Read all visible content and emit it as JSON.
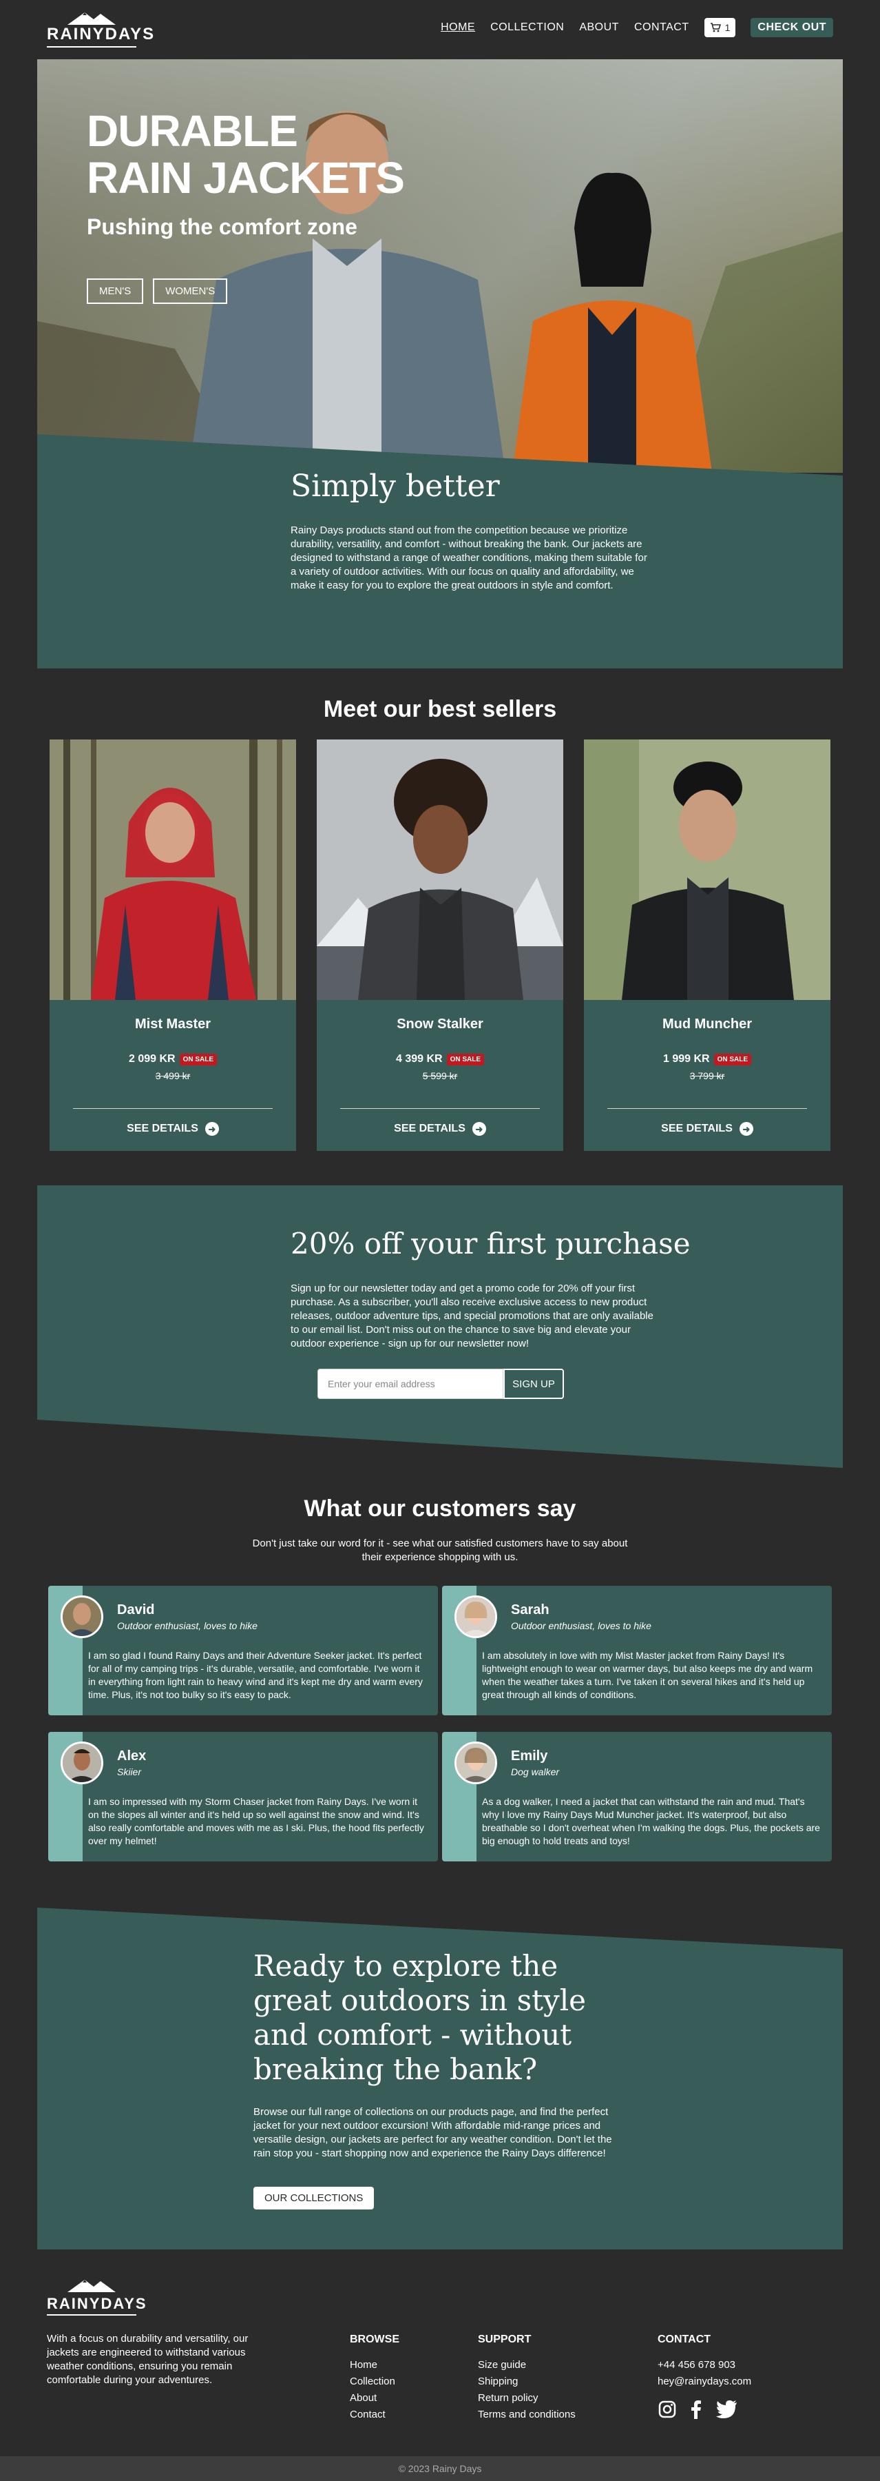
{
  "brand": {
    "logo_text": "RAINYDAYS"
  },
  "nav": {
    "items": [
      {
        "label": "HOME"
      },
      {
        "label": "COLLECTION"
      },
      {
        "label": "ABOUT"
      },
      {
        "label": "CONTACT"
      }
    ],
    "cart_count": "1",
    "checkout_label": "CHECK OUT"
  },
  "hero": {
    "title_line1": "DURABLE",
    "title_line2": "RAIN JACKETS",
    "subtitle": "Pushing the comfort zone",
    "btn_mens": "MEN'S",
    "btn_womens": "WOMEN'S"
  },
  "intro": {
    "title": "Simply better",
    "text": "Rainy Days products stand out from the competition because we prioritize durability, versatility, and comfort - without breaking the bank. Our jackets are designed to withstand a range of weather conditions, making them suitable for a variety of outdoor activities. With our focus on quality and affordability, we make it easy for you to explore the great outdoors in style and comfort."
  },
  "best_sellers": {
    "title": "Meet our best sellers",
    "products": [
      {
        "name": "Mist Master",
        "price": "2 099 KR",
        "badge": "ON SALE",
        "old_price": "3 499 kr",
        "cta": "SEE DETAILS"
      },
      {
        "name": "Snow Stalker",
        "price": "4 399 KR",
        "badge": "ON SALE",
        "old_price": "5 599 kr",
        "cta": "SEE DETAILS"
      },
      {
        "name": "Mud Muncher",
        "price": "1 999 KR",
        "badge": "ON SALE",
        "old_price": "3 799 kr",
        "cta": "SEE DETAILS"
      }
    ]
  },
  "newsletter": {
    "title": "20% off your first purchase",
    "text": "Sign up for our newsletter today and get a promo code for 20% off your first purchase. As a subscriber, you'll also receive exclusive access to new product releases, outdoor adventure tips, and special promotions that are only available to our email list. Don't miss out on the chance to save big and elevate your outdoor experience - sign up for our newsletter now!",
    "placeholder": "Enter your email address",
    "button": "SIGN UP"
  },
  "testimonials": {
    "title": "What our customers say",
    "subtitle": "Don't just take our word for it - see what our satisfied customers have to say about their experience shopping with us.",
    "items": [
      {
        "name": "David",
        "role": "Outdoor enthusiast, loves to hike",
        "text": "I am so glad I found Rainy Days and their Adventure Seeker jacket. It's perfect for all of my camping trips - it's durable, versatile, and comfortable. I've worn it in everything from light rain to heavy wind and it's kept me dry and warm every time. Plus, it's not too bulky so it's easy to pack."
      },
      {
        "name": "Sarah",
        "role": "Outdoor enthusiast, loves to hike",
        "text": "I am absolutely in love with my Mist Master jacket from Rainy Days! It's lightweight enough to wear on warmer days, but also keeps me dry and warm when the weather takes a turn. I've taken it on several hikes and it's held up great through all kinds of conditions."
      },
      {
        "name": "Alex",
        "role": "Skiier",
        "text": "I am so impressed with my Storm Chaser jacket from Rainy Days. I've worn it on the slopes all winter and it's held up so well against the snow and wind. It's also really comfortable and moves with me as I ski. Plus, the hood fits perfectly over my helmet!"
      },
      {
        "name": "Emily",
        "role": "Dog walker",
        "text": "As a dog walker, I need a jacket that can withstand the rain and mud. That's why I love my Rainy Days Mud Muncher jacket. It's waterproof, but also breathable so I don't overheat when I'm walking the dogs. Plus, the pockets are big enough to hold treats and toys!"
      }
    ]
  },
  "cta": {
    "title": "Ready to explore the great outdoors in style and comfort - without breaking the bank?",
    "text": "Browse our full range of collections on our products page, and find the perfect jacket for your next outdoor excursion! With affordable mid-range prices and versatile design, our jackets are perfect for any weather condition. Don't let the rain stop you - start shopping now and experience the Rainy Days difference!",
    "button": "OUR COLLECTIONS"
  },
  "footer": {
    "about": "With a focus on durability and versatility, our jackets are engineered to withstand various weather conditions, ensuring you remain comfortable during your adventures.",
    "browse_title": "BROWSE",
    "browse": [
      "Home",
      "Collection",
      "About",
      "Contact"
    ],
    "support_title": "SUPPORT",
    "support": [
      "Size guide",
      "Shipping",
      "Return policy",
      "Terms and conditions"
    ],
    "contact_title": "CONTACT",
    "phone": "+44 456 678 903",
    "email": "hey@rainydays.com",
    "social": [
      "instagram-icon",
      "facebook-icon",
      "twitter-icon"
    ],
    "copyright": "© 2023 Rainy Days"
  },
  "colors": {
    "accent": "#385c57",
    "sale": "#c0191f",
    "strip": "#7eb9b2",
    "background": "#2b2b2b"
  }
}
